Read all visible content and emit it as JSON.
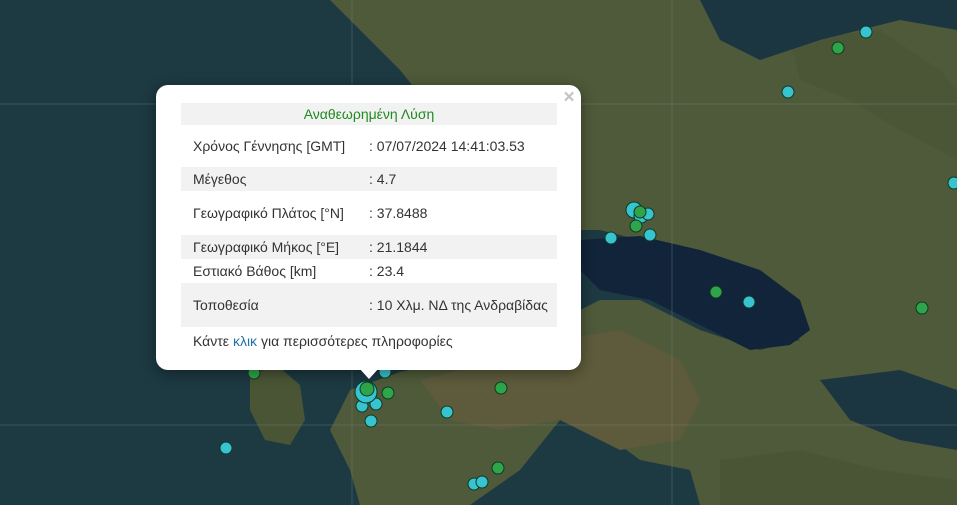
{
  "popup": {
    "title": "Αναθεωρημένη Λύση",
    "close_symbol": "×",
    "rows": [
      {
        "label": "Χρόνος Γέννησης [GMT]",
        "value": ": 07/07/2024 14:41:03.53"
      },
      {
        "label": "Μέγεθος",
        "value": ": 4.7"
      },
      {
        "label": "Γεωγραφικό Πλάτος [°N]",
        "value": ": 37.8488"
      },
      {
        "label": "Γεωγραφικό Μήκος [°E]",
        "value": ": 21.1844"
      },
      {
        "label": "Εστιακό Βάθος [km]",
        "value": ": 23.4"
      },
      {
        "label": "Τοποθεσία",
        "value": ": 10 Χλμ. ΝΔ της Ανδραβίδας"
      }
    ],
    "more_prefix": "Κάντε",
    "more_link": "κλικ",
    "more_suffix": "για περισσότερες πληροφορίες"
  },
  "marker_colors": {
    "cyan": "#38c3d0",
    "green": "#2ea54a",
    "outline": "#0d3a22"
  }
}
